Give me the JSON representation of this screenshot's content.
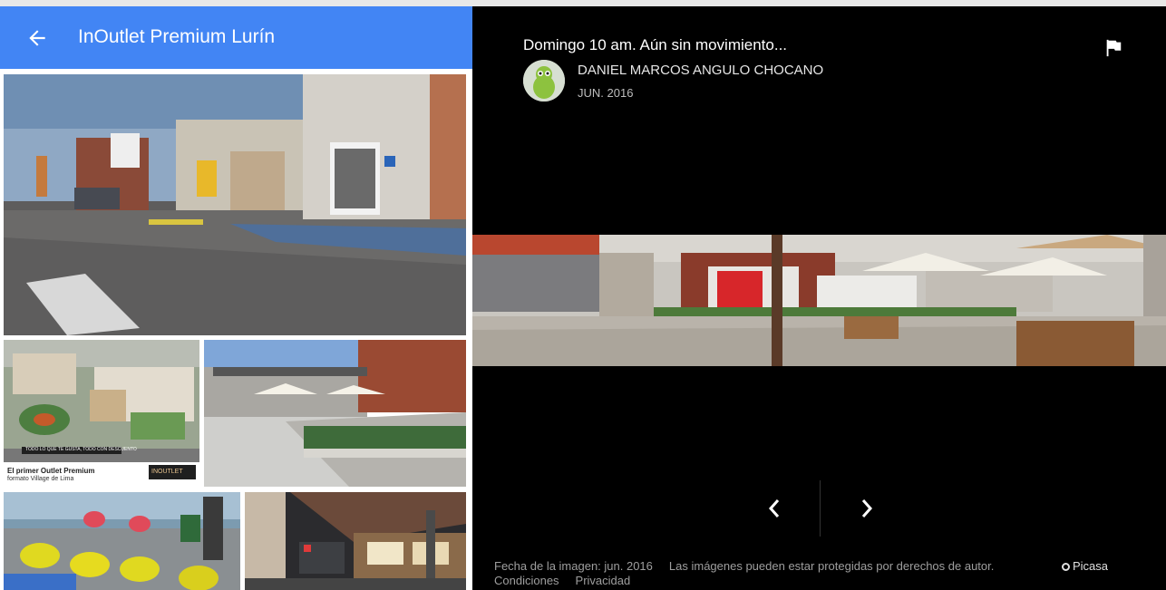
{
  "header": {
    "title": "InOutlet Premium Lurín"
  },
  "photo": {
    "title": "Domingo 10 am. Aún sin movimiento...",
    "author": "DANIEL MARCOS ANGULO CHOCANO",
    "date": "JUN. 2016"
  },
  "thumbs": {
    "promo_line1": "El primer Outlet Premium",
    "promo_line2": "formato Village de Lima",
    "promo_banner": "TODO LO QUE TE GUSTA, TODO CON DESCUENTO",
    "promo_brand": "INOUTLET"
  },
  "footer": {
    "image_date": "Fecha de la imagen: jun. 2016",
    "copyright": "Las imágenes pueden estar protegidas por derechos de autor.",
    "terms": "Condiciones",
    "privacy": "Privacidad",
    "source": "Picasa"
  },
  "colors": {
    "header_bg": "#4285f4",
    "viewer_bg": "#000000"
  }
}
